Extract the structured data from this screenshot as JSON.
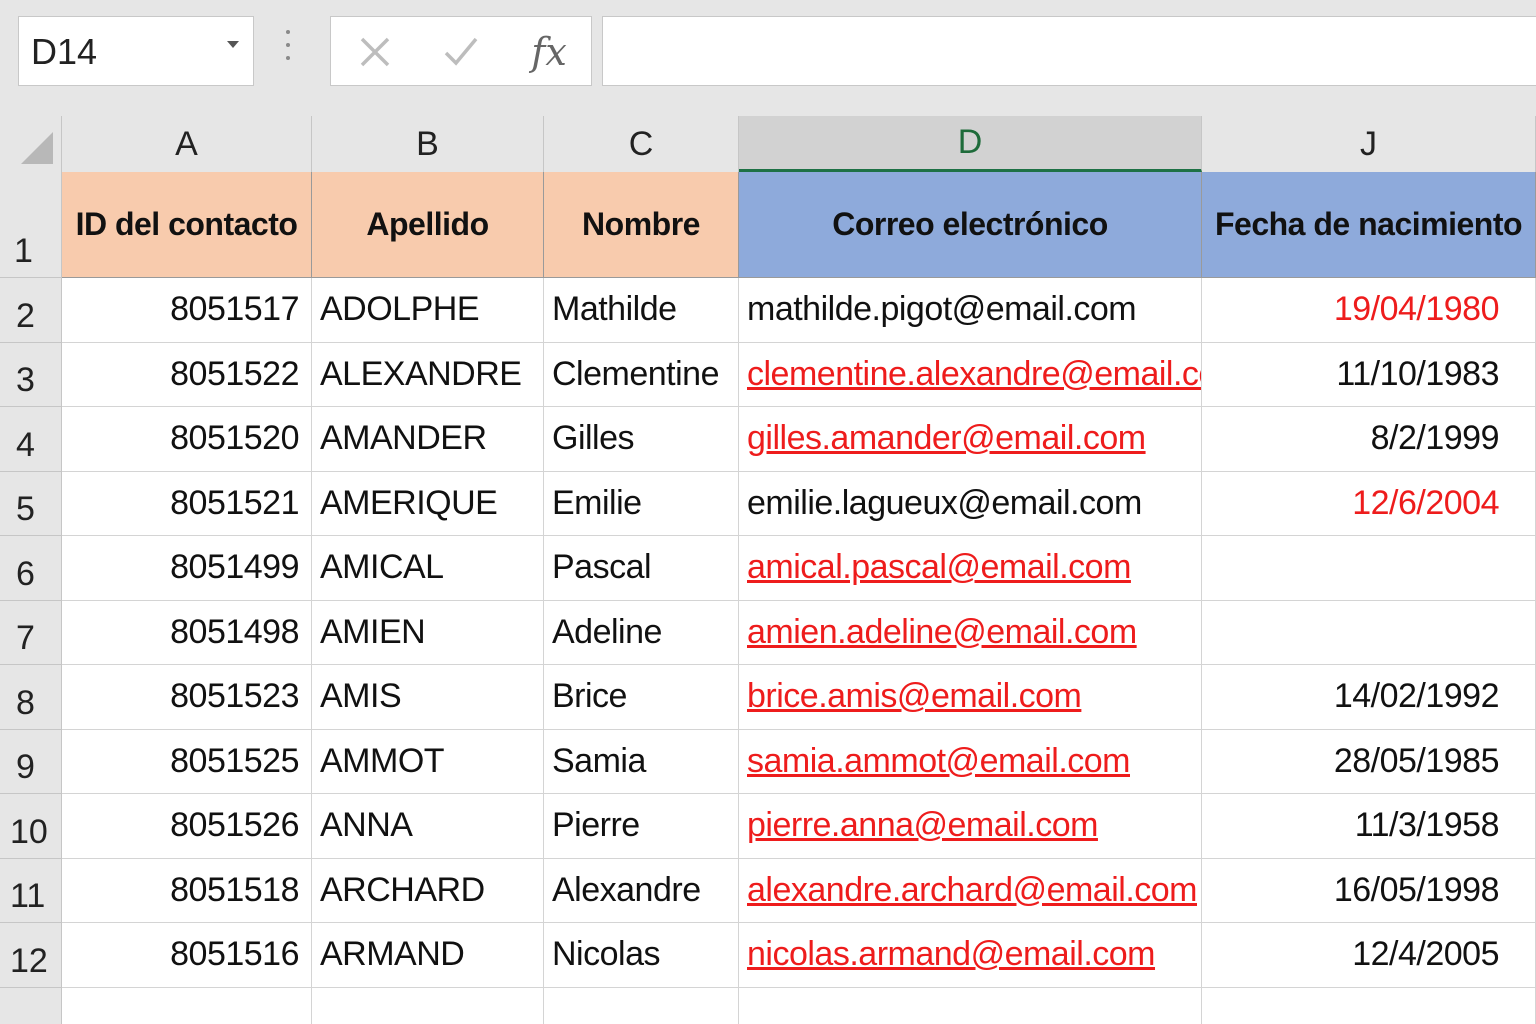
{
  "formula_bar": {
    "name_box": "D14",
    "formula_value": ""
  },
  "icons": {
    "cancel": "close-icon",
    "enter": "check-icon",
    "function": "fx-icon",
    "fx_label": "fx"
  },
  "columns": [
    "A",
    "B",
    "C",
    "D",
    "J"
  ],
  "active_column": "D",
  "header_row": {
    "row_number": "1",
    "cells": [
      "ID del contacto",
      "Apellido",
      "Nombre",
      "Correo electrónico",
      "Fecha de nacimiento"
    ]
  },
  "rows": [
    {
      "row_number": "2",
      "id": "8051517",
      "apellido": "ADOLPHE",
      "nombre": "Mathilde",
      "correo": "mathilde.pigot@email.com",
      "correo_style": "plain",
      "fecha": "19/04/1980",
      "fecha_style": "red"
    },
    {
      "row_number": "3",
      "id": "8051522",
      "apellido": "ALEXANDRE",
      "nombre": "Clementine",
      "correo": "clementine.alexandre@email.com",
      "correo_style": "link",
      "fecha": "11/10/1983",
      "fecha_style": "plain"
    },
    {
      "row_number": "4",
      "id": "8051520",
      "apellido": "AMANDER",
      "nombre": "Gilles",
      "correo": "gilles.amander@email.com",
      "correo_style": "link",
      "fecha": "8/2/1999",
      "fecha_style": "plain"
    },
    {
      "row_number": "5",
      "id": "8051521",
      "apellido": "AMERIQUE",
      "nombre": "Emilie",
      "correo": "emilie.lagueux@email.com",
      "correo_style": "plain",
      "fecha": "12/6/2004",
      "fecha_style": "red"
    },
    {
      "row_number": "6",
      "id": "8051499",
      "apellido": "AMICAL",
      "nombre": "Pascal",
      "correo": "amical.pascal@email.com",
      "correo_style": "link",
      "fecha": "",
      "fecha_style": "plain"
    },
    {
      "row_number": "7",
      "id": "8051498",
      "apellido": "AMIEN",
      "nombre": "Adeline",
      "correo": "amien.adeline@email.com",
      "correo_style": "link",
      "fecha": "",
      "fecha_style": "plain"
    },
    {
      "row_number": "8",
      "id": "8051523",
      "apellido": "AMIS",
      "nombre": "Brice",
      "correo": "brice.amis@email.com",
      "correo_style": "link",
      "fecha": "14/02/1992",
      "fecha_style": "plain"
    },
    {
      "row_number": "9",
      "id": "8051525",
      "apellido": "AMMOT",
      "nombre": "Samia",
      "correo": "samia.ammot@email.com",
      "correo_style": "link",
      "fecha": "28/05/1985",
      "fecha_style": "plain"
    },
    {
      "row_number": "10",
      "id": "8051526",
      "apellido": "ANNA",
      "nombre": "Pierre",
      "correo": "pierre.anna@email.com",
      "correo_style": "link",
      "fecha": "11/3/1958",
      "fecha_style": "plain"
    },
    {
      "row_number": "11",
      "id": "8051518",
      "apellido": "ARCHARD",
      "nombre": "Alexandre",
      "correo": "alexandre.archard@email.com",
      "correo_style": "link",
      "fecha": "16/05/1998",
      "fecha_style": "plain"
    },
    {
      "row_number": "12",
      "id": "8051516",
      "apellido": "ARMAND",
      "nombre": "Nicolas",
      "correo": "nicolas.armand@email.com",
      "correo_style": "link",
      "fecha": "12/4/2005",
      "fecha_style": "plain"
    }
  ],
  "colors": {
    "header_peach": "#f8cbad",
    "header_blue": "#8eaadb",
    "highlight_red": "#ee1c1c",
    "active_column_green": "#1e7145"
  }
}
